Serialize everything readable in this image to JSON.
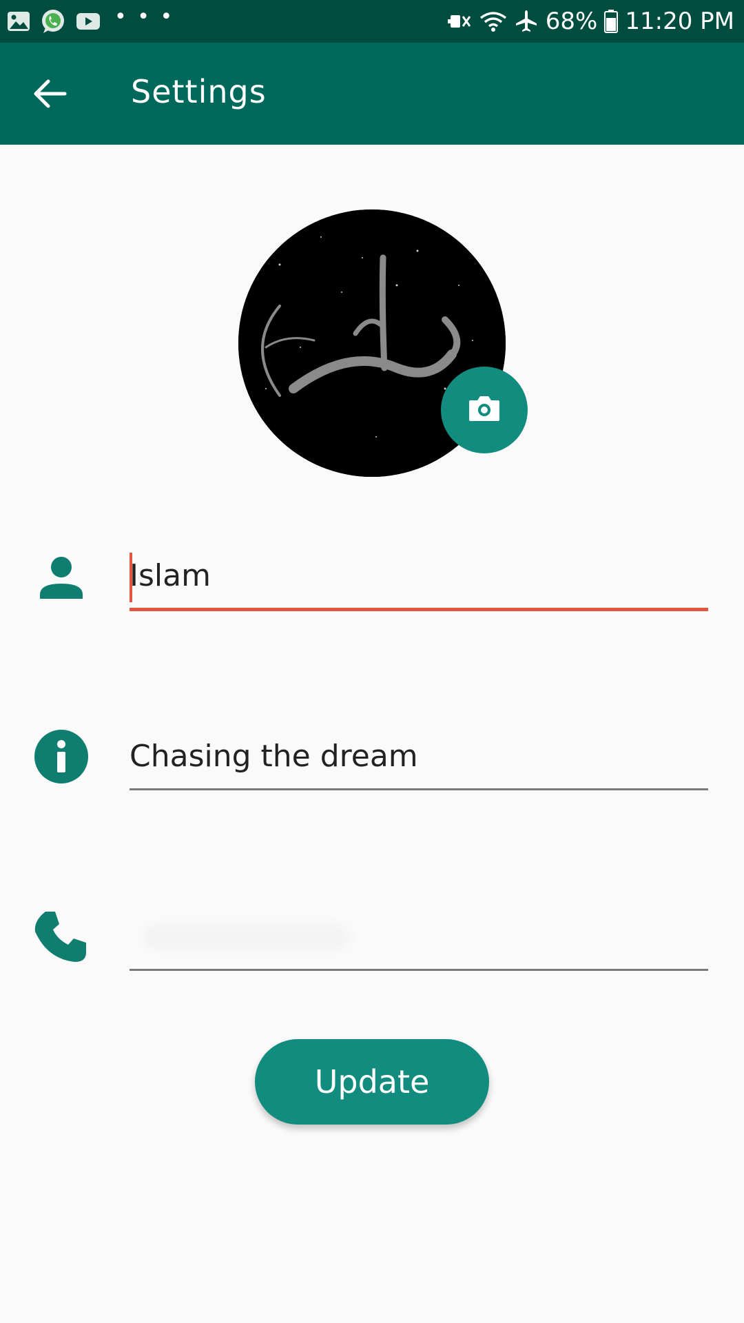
{
  "status_bar": {
    "battery": "68%",
    "time": "11:20 PM",
    "left_icons": [
      "gallery-icon",
      "whatsapp-icon",
      "youtube-icon",
      "more-notifications-icon"
    ],
    "right_icons": [
      "mute-icon",
      "wifi-icon",
      "airplane-mode-icon",
      "battery-icon"
    ],
    "background": "#004d40"
  },
  "toolbar": {
    "title": "Settings",
    "back_icon": "arrow-back-icon",
    "background": "#00695c"
  },
  "profile": {
    "avatar_icon": "profile-avatar-image",
    "camera_icon": "camera-icon",
    "accent": "#128c7e"
  },
  "fields": {
    "name": {
      "icon": "person-icon",
      "value": "Islam",
      "focused": true,
      "underline_color": "#e2583e"
    },
    "about": {
      "icon": "info-icon",
      "value": "Chasing the dream"
    },
    "phone": {
      "icon": "phone-icon",
      "value": ""
    }
  },
  "update_button": {
    "label": "Update",
    "color": "#128c7e"
  }
}
